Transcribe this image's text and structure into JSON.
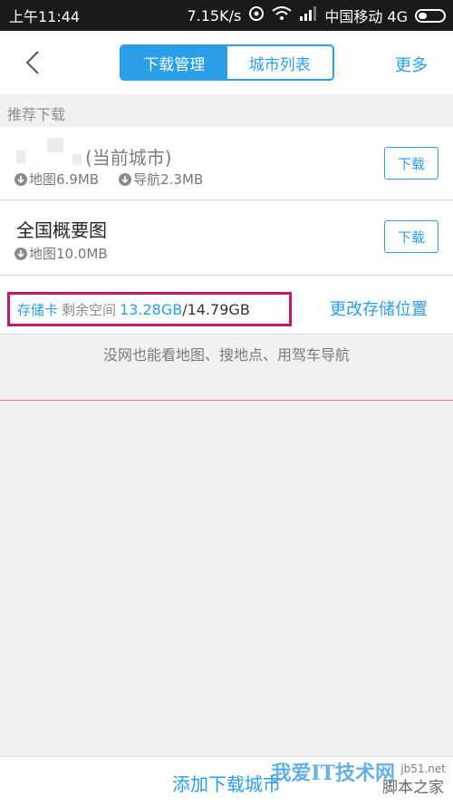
{
  "status_bar": {
    "time": "上午11:44",
    "speed": "7.15K/s",
    "carrier": "中国移动 4G"
  },
  "nav": {
    "tabs": [
      {
        "label": "下载管理",
        "active": true
      },
      {
        "label": "城市列表",
        "active": false
      }
    ],
    "more_label": "更多"
  },
  "section": {
    "recommended_title": "推荐下载"
  },
  "rows": [
    {
      "title": "(当前城市)",
      "map_size": "地图6.9MB",
      "nav_size": "导航2.3MB",
      "button_label": "下载"
    },
    {
      "title": "全国概要图",
      "map_size": "地图10.0MB",
      "button_label": "下载"
    }
  ],
  "storage": {
    "card_label": "存储卡",
    "free_label": "剩余空间",
    "free_value": "13.28GB",
    "separator": "/",
    "total_value": "14.79GB",
    "change_label": "更改存储位置"
  },
  "offline_tip": "没网也能看地图、搜地点、用驾车导航",
  "bottom": {
    "add_city_label": "添加下载城市"
  },
  "watermark": {
    "text1": "我爱IT技术网",
    "text2": "jb51.net",
    "text3": "脚本之家"
  },
  "colors": {
    "accent": "#2b9ee8",
    "highlight_border": "#c3176b",
    "divider_red": "#ef6f6f"
  }
}
